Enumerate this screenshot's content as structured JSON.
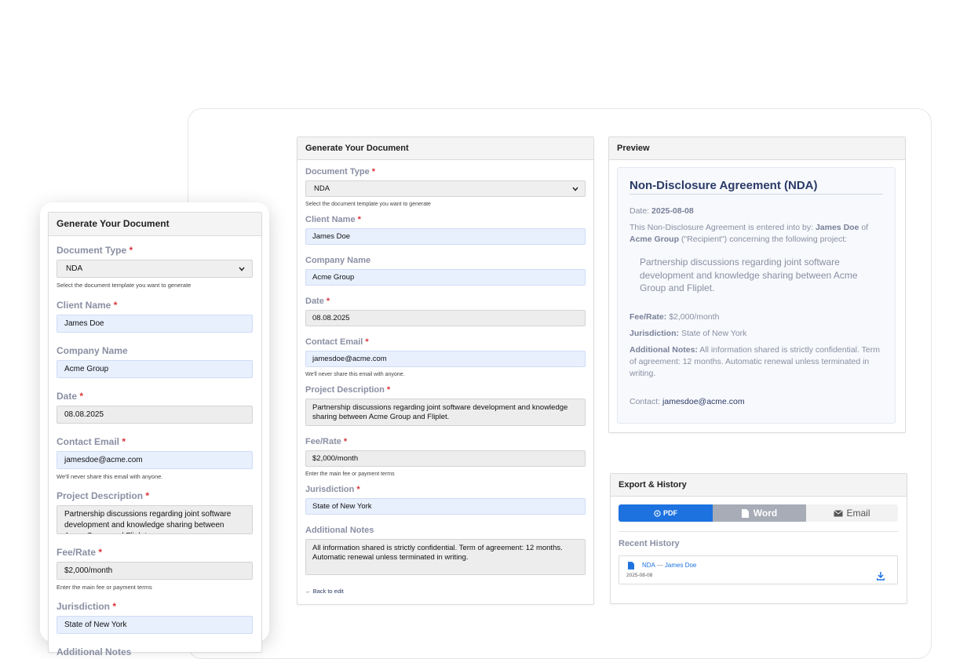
{
  "form": {
    "title": "Generate Your Document",
    "doc_type_label": "Document Type",
    "doc_type_value": "NDA",
    "doc_type_help": "Select the document template you want to generate",
    "client_label": "Client Name",
    "client_value": "James Doe",
    "company_label": "Company Name",
    "company_value": "Acme Group",
    "date_label": "Date",
    "date_value": "08.08.2025",
    "email_label": "Contact Email",
    "email_value": "jamesdoe@acme.com",
    "email_help": "We'll never share this email with anyone.",
    "project_label": "Project Description",
    "project_value": "Partnership discussions regarding joint software development and knowledge sharing between Acme Group and Fliplet.",
    "fee_label": "Fee/Rate",
    "fee_value": "$2,000/month",
    "fee_help": "Enter the main fee or payment terms",
    "jurisdiction_label": "Jurisdiction",
    "jurisdiction_value": "State of New York",
    "notes_label": "Additional Notes",
    "notes_value": "All information shared is strictly confidential. Term of agreement: 12 months. Automatic renewal unless terminated in writing.",
    "back_link": "← Back to edit",
    "required_mark": "*"
  },
  "preview": {
    "title": "Preview",
    "doc_title": "Non-Disclosure Agreement (NDA)",
    "date_label": "Date:",
    "date_value": "2025-08-08",
    "intro_1": "This Non-Disclosure Agreement is entered into by:",
    "client": "James Doe",
    "of": "of",
    "company": "Acme Group",
    "intro_2": "(\"Recipient\") concerning the following project:",
    "project": "Partnership discussions regarding joint software development and knowledge sharing between Acme Group and Fliplet.",
    "fee_label": "Fee/Rate:",
    "fee_value": "$2,000/month",
    "jurisdiction_label": "Jurisdiction:",
    "jurisdiction_value": "State of New York",
    "notes_label": "Additional Notes:",
    "notes_value": "All information shared is strictly confidential. Term of agreement: 12 months. Automatic renewal unless terminated in writing.",
    "contact_label": "Contact:",
    "contact_value": "jamesdoe@acme.com"
  },
  "export": {
    "title": "Export & History",
    "pdf": "PDF",
    "word": "Word",
    "email": "Email",
    "history_title": "Recent History",
    "history_type": "NDA",
    "history_sep": "—",
    "history_client": "James Doe",
    "history_date": "2025-08-08"
  },
  "mobile_form": {
    "notes_label_partial": "Additional Notes"
  },
  "colors": {
    "accent": "#1d72e0",
    "required": "#d9343a",
    "label": "#8a8fa3",
    "input_blue": "#e8f0fe",
    "doc_title": "#2b3a67"
  },
  "icons": [
    "chevron-down-icon",
    "download-icon",
    "file-icon",
    "envelope-icon",
    "info-circle-icon"
  ]
}
